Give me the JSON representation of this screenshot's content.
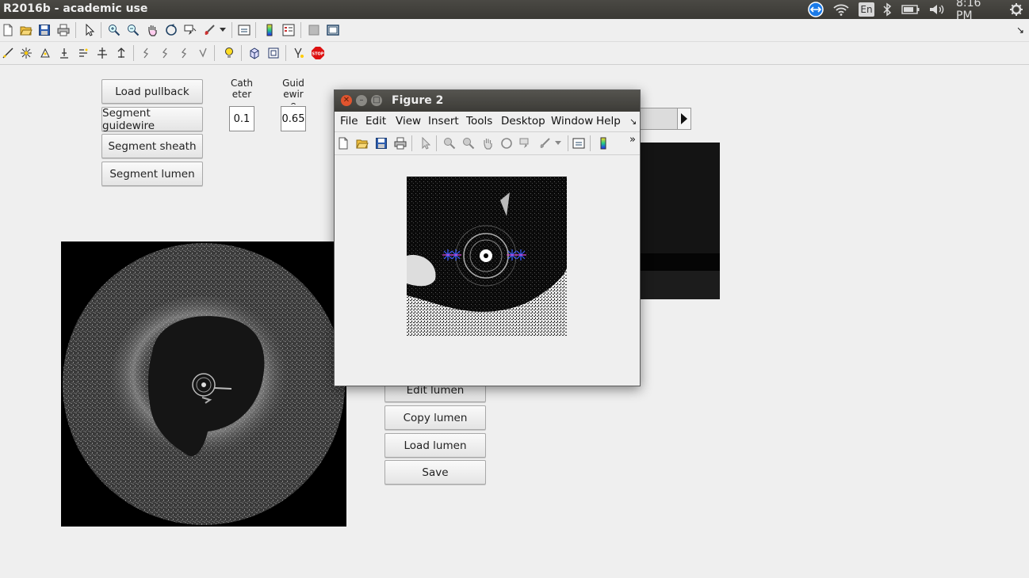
{
  "system_bar": {
    "app_title": "R2016b - academic use",
    "keyboard_layout": "En",
    "clock": "8:16 PM"
  },
  "toolbar1_icons": [
    "new-file-icon",
    "open-folder-icon",
    "save-icon",
    "print-icon",
    "pointer-icon",
    "zoom-in-icon",
    "zoom-out-icon",
    "pan-hand-icon",
    "rotate-3d-icon",
    "data-cursor-icon",
    "brush-icon",
    "dropdown-arrow-icon",
    "link-plot-icon",
    "colorbar-icon",
    "legend-icon",
    "hide-tools-icon",
    "dock-icon"
  ],
  "toolbar2_icons": [
    "tool-a-icon",
    "tool-b-icon",
    "tool-c-icon",
    "tool-d-icon",
    "tool-e-icon",
    "tool-f-icon",
    "tool-g-icon",
    "tool-h-icon",
    "tool-i-icon",
    "tool-j-icon",
    "tool-k-icon",
    "lightbulb-icon",
    "cube-icon",
    "cube-outline-icon",
    "tool-l-icon",
    "stop-icon"
  ],
  "controls": {
    "load_pullback": "Load pullback",
    "segment_guidewire": "Segment guidewire",
    "segment_sheath": "Segment sheath",
    "segment_lumen": "Segment lumen",
    "catheter_label": "Cath\neter",
    "guidewire_label": "Guid\newir\ne",
    "catheter_value": "0.1",
    "guidewire_value": "0.65",
    "edit_lumen": "Edit lumen",
    "copy_lumen": "Copy lumen",
    "load_lumen": "Load lumen",
    "save": "Save"
  },
  "figure_window": {
    "title": "Figure 2",
    "menu": [
      "File",
      "Edit",
      "View",
      "Insert",
      "Tools",
      "Desktop",
      "Window",
      "Help"
    ],
    "menu_overflow": "↘",
    "toolbar_overflow": "»"
  },
  "colors": {
    "top_bar": "#3c3b37",
    "background": "#efefef",
    "close_button": "#e0542e",
    "marker": "#3a5dff"
  }
}
